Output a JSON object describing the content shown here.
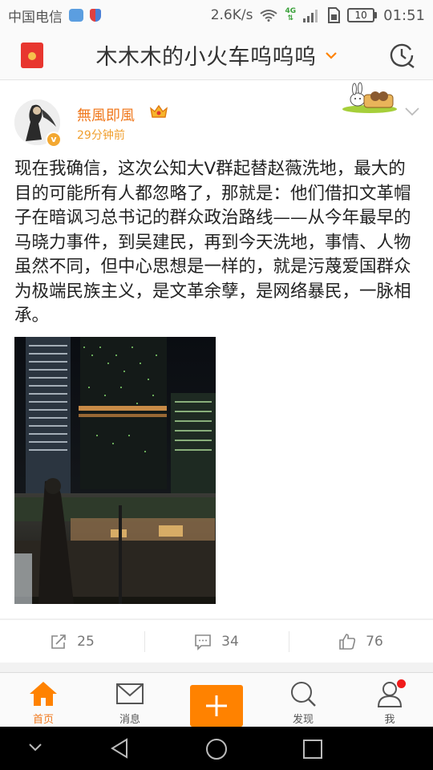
{
  "status_bar": {
    "carrier": "中国电信",
    "net_speed": "2.6K/s",
    "net_type": "4G",
    "battery": "10",
    "time": "01:51"
  },
  "header": {
    "title": "木木木的小火车呜呜呜",
    "icons": [
      "red-packet-icon",
      "chevron-down-icon",
      "clock-icon"
    ],
    "accent": "#ff8200"
  },
  "post": {
    "username": "無風即風",
    "time": "29分钟前",
    "text": "现在我确信，这次公知大V群起替赵薇洗地，最大的目的可能所有人都忽略了，那就是：他们借扣文革帽子在暗讽习总书记的群众政治路线——从今年最早的马晓力事件，到吴建民，再到今天洗地，事情、人物虽然不同，但中心思想是一样的，就是污蔑爱国群众为极端民族主义，是文革余孽，是网络暴民，一脉相承。",
    "username_color": "#f0791e"
  },
  "actions": {
    "repost_count": "25",
    "comment_count": "34",
    "like_count": "76"
  },
  "tabs": [
    {
      "label": "首页",
      "icon": "home-icon",
      "active": true
    },
    {
      "label": "消息",
      "icon": "mail-icon",
      "active": false
    },
    {
      "label": "",
      "icon": "plus-icon",
      "active": false
    },
    {
      "label": "发现",
      "icon": "search-icon",
      "active": false
    },
    {
      "label": "我",
      "icon": "person-icon",
      "active": false
    }
  ]
}
